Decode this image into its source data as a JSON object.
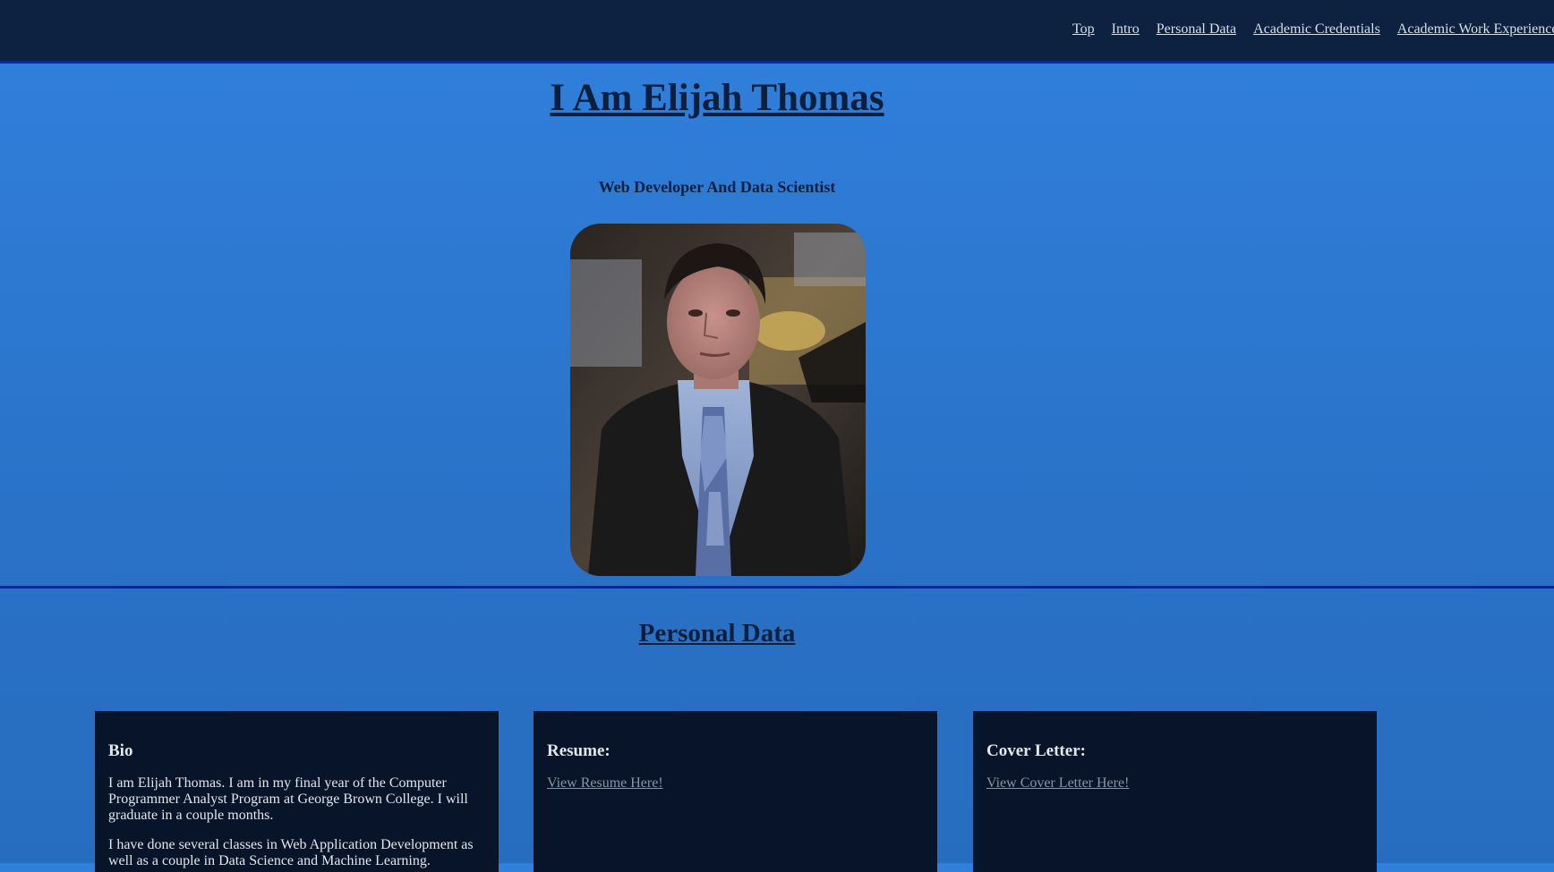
{
  "nav": {
    "items": [
      {
        "label": "Top"
      },
      {
        "label": "Intro"
      },
      {
        "label": "Personal Data"
      },
      {
        "label": "Academic Credentials"
      },
      {
        "label": "Academic Work Experience"
      }
    ]
  },
  "hero": {
    "title": "I Am Elijah Thomas",
    "subtitle": "Web Developer And Data Scientist"
  },
  "personal": {
    "section_title": "Personal Data",
    "bio": {
      "heading": "Bio",
      "paragraphs": [
        "I am Elijah Thomas. I am in my final year of the Computer Programmer Analyst Program at George Brown College. I will graduate in a couple months.",
        "I have done several classes in Web Application Development as well as a couple in Data Science and Machine Learning."
      ]
    },
    "resume": {
      "heading": "Resume:",
      "link": "View Resume Here!"
    },
    "cover_letter": {
      "heading": "Cover Letter:",
      "link": "View Cover Letter Here!"
    }
  },
  "colors": {
    "navbar_bg": "#0d2240",
    "page_bg": "#2e7bd6",
    "card_bg": "#07142a",
    "heading_text": "#0c1f3e",
    "divider": "#0a21a6"
  }
}
